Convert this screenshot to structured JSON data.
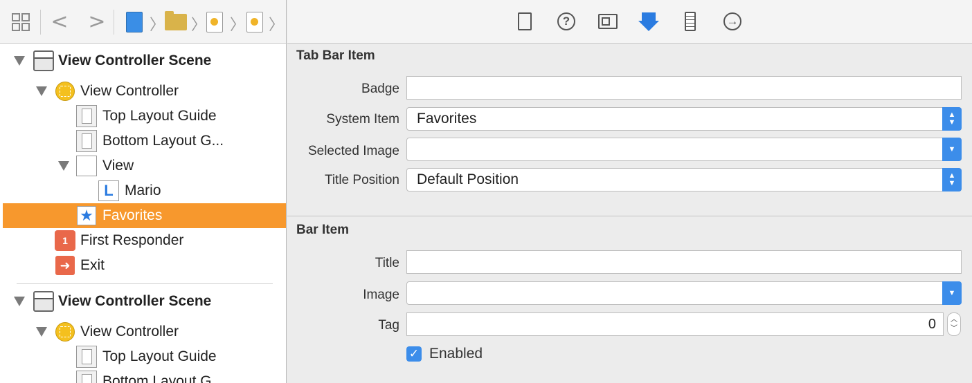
{
  "navigator": {
    "jumpbar": {
      "grid_icon": "related-items-grid-icon",
      "back_glyph": "<",
      "forward_glyph": ">"
    },
    "tree": [
      {
        "label": "View Controller Scene",
        "icon": "scene-icon",
        "expanded": true,
        "bold": true
      },
      {
        "label": "View Controller",
        "icon": "view-controller-icon",
        "expanded": true
      },
      {
        "label": "Top Layout Guide",
        "icon": "layout-guide-icon"
      },
      {
        "label": "Bottom Layout G...",
        "icon": "layout-guide-icon"
      },
      {
        "label": "View",
        "icon": "view-icon",
        "expanded": true
      },
      {
        "label": "Mario",
        "icon": "label-icon",
        "glyph": "L"
      },
      {
        "label": "Favorites",
        "icon": "star-icon",
        "glyph": "★",
        "selected": true
      },
      {
        "label": "First Responder",
        "icon": "first-responder-icon",
        "glyph": "1"
      },
      {
        "label": "Exit",
        "icon": "exit-icon",
        "glyph": "➜"
      },
      {
        "label": "View Controller Scene",
        "icon": "scene-icon",
        "expanded": true,
        "bold": true
      },
      {
        "label": "View Controller",
        "icon": "view-controller-icon",
        "expanded": true
      },
      {
        "label": "Top Layout Guide",
        "icon": "layout-guide-icon"
      },
      {
        "label": "Bottom Layout G...",
        "icon": "layout-guide-icon"
      }
    ],
    "selection_color": "#f7982d"
  },
  "inspector": {
    "tabs": [
      {
        "name": "file-inspector-icon"
      },
      {
        "name": "quick-help-icon",
        "glyph": "?"
      },
      {
        "name": "identity-inspector-icon"
      },
      {
        "name": "attributes-inspector-icon",
        "active": true
      },
      {
        "name": "size-inspector-icon"
      },
      {
        "name": "connections-inspector-icon",
        "glyph": "→"
      }
    ],
    "tab_bar_item": {
      "title": "Tab Bar Item",
      "badge_label": "Badge",
      "badge_value": "",
      "system_item_label": "System Item",
      "system_item_value": "Favorites",
      "selected_image_label": "Selected Image",
      "selected_image_value": "",
      "title_position_label": "Title Position",
      "title_position_value": "Default Position"
    },
    "bar_item": {
      "title": "Bar Item",
      "title_label": "Title",
      "title_value": "",
      "image_label": "Image",
      "image_value": "",
      "tag_label": "Tag",
      "tag_value": "0",
      "enabled_label": "Enabled",
      "enabled_checked": true
    },
    "accent_color": "#3c8dea"
  }
}
